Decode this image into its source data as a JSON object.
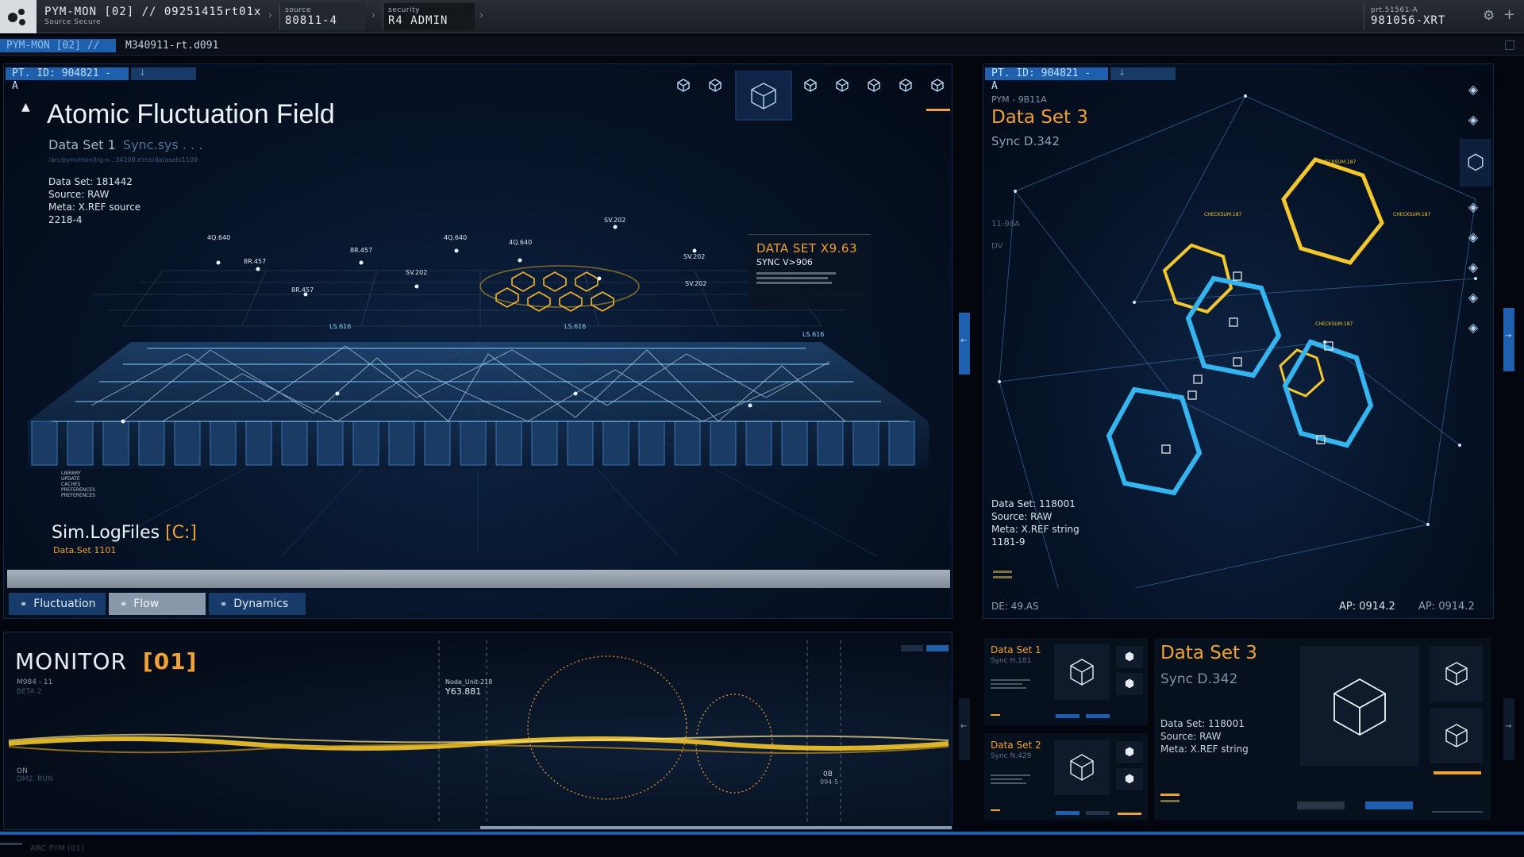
{
  "topbar": {
    "app_title": "PYM-MON [02] // 09251415rt01x",
    "app_subtitle": "Source Secure",
    "source_label": "source",
    "source_value": "80811-4",
    "security_label": "security",
    "security_value": "R4 ADMIN",
    "right_label": "prt.51561-A",
    "right_value": "981056-XRT"
  },
  "crumb": {
    "tab": "PYM-MON [02] //",
    "path": "M340911-rt.d091"
  },
  "left_panel": {
    "pt_id": "PT. ID: 904821 - A",
    "title": "Atomic Fluctuation Field",
    "subtitle": "Data Set 1",
    "subtitle_sync": "Sync.sys . . .",
    "path_text": "/arc/pym/mon/lrg-x...34208.rtms/datasets1109",
    "meta": [
      "Data Set: 181442",
      "Source: RAW",
      "Meta: X.REF source",
      "2218-4"
    ],
    "callout_title": "DATA SET X9.63",
    "callout_sync": "SYNC V>906",
    "node_labels": [
      "SV.202",
      "8R.457",
      "4Q.640",
      "8R.457",
      "SV.202",
      "4Q.640",
      "8R.457",
      "SV.202",
      "4Q.640",
      "SV.202",
      "LS.616",
      "LS.616",
      "LS.616"
    ],
    "logfiles_title": "Sim.LogFiles",
    "logfiles_drive": "[C:]",
    "logfiles_sub": "Data.Set 1101",
    "tree": [
      "LIBRARY",
      "UPDATE",
      "CACHES",
      "PREFERENCES",
      "PREFERENCES"
    ],
    "tabs": [
      "Fluctuation",
      "Flow",
      "Dynamics"
    ]
  },
  "right_panel": {
    "pt_id": "PT. ID: 904821 - A",
    "code": "PYM - 9B11A",
    "title": "Data Set 3",
    "sync": "Sync D.342",
    "side_labels": [
      "11-98A",
      "DV"
    ],
    "meta": [
      "Data Set: 118001",
      "Source: RAW",
      "Meta: X.REF string",
      "1181-9"
    ],
    "footer_left": "DE: 49.AS",
    "footer_ap1": "AP: 0914.2",
    "footer_ap2": "AP: 0914.2",
    "hex_labels": [
      "CHECKSUM.187",
      "CHECKSUM.187",
      "CHECKSUM.187",
      "CHECKSUM.187"
    ]
  },
  "monitor": {
    "title": "MONITOR",
    "index": "[01]",
    "sub1": "M984 - 11",
    "sub2": "BETA 2",
    "node_label": "Node_Unit-218",
    "node_value": "Y63.881",
    "left_tag1": "ON",
    "left_tag2": "DM2. RUN",
    "right_tag1": "0B",
    "right_tag2": "994-5"
  },
  "mini1": {
    "title": "Data Set 1",
    "sync": "Sync H.181"
  },
  "mini2": {
    "title": "Data Set 2",
    "sync": "Sync N.429"
  },
  "detail": {
    "title": "Data Set 3",
    "sync": "Sync D.342",
    "meta": [
      "Data Set: 118001",
      "Source: RAW",
      "Meta: X.REF string"
    ]
  },
  "footer": {
    "text": "ARC PYM [01]"
  },
  "colors": {
    "accent": "#f0a234",
    "blue": "#1e5fae",
    "cyan": "#35b5f0",
    "yellow": "#f4c72a"
  }
}
